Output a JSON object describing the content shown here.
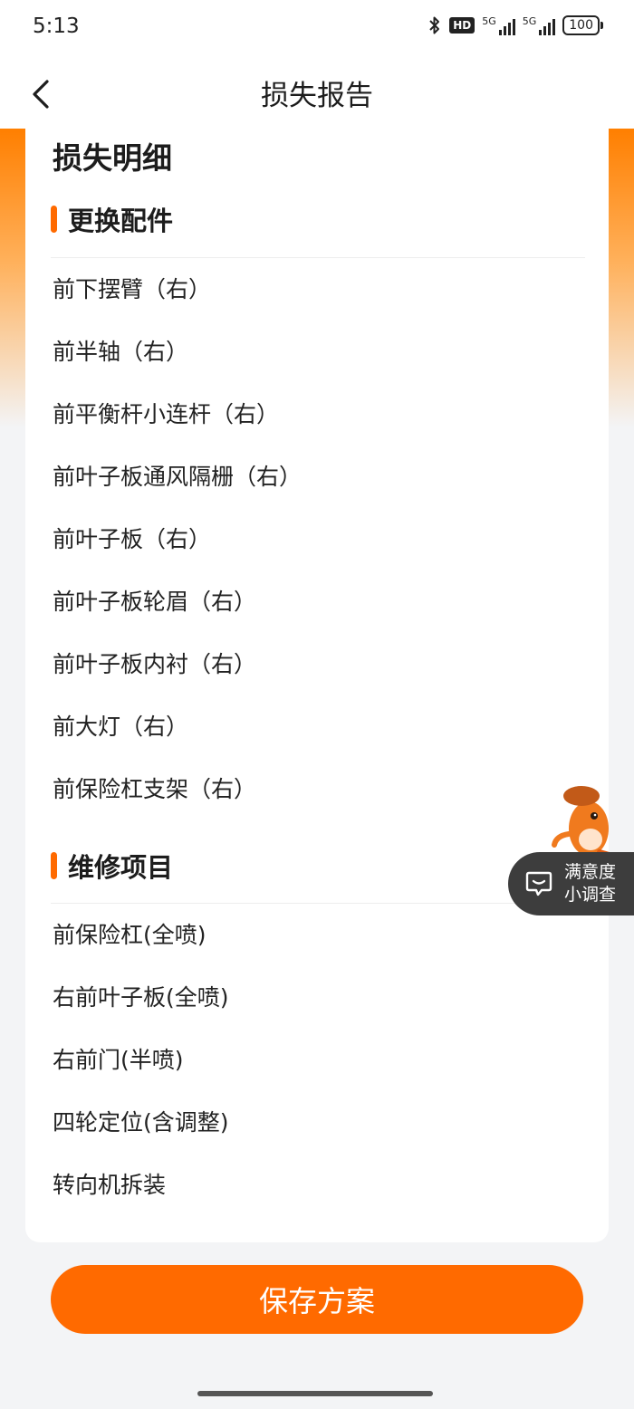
{
  "status_bar": {
    "time": "5:13",
    "hd_label": "HD",
    "network_1": "5G",
    "network_2": "5G",
    "battery": "100",
    "icons": [
      "bluetooth-icon",
      "hd-voice-icon",
      "signal-icon",
      "signal-icon",
      "battery-icon"
    ]
  },
  "header": {
    "title": "损失报告",
    "back_icon": "chevron-left-icon"
  },
  "card": {
    "title": "损失明细",
    "sections": [
      {
        "title": "更换配件",
        "items": [
          "前下摆臂（右）",
          "前半轴（右）",
          "前平衡杆小连杆（右）",
          "前叶子板通风隔栅（右）",
          "前叶子板（右）",
          "前叶子板轮眉（右）",
          "前叶子板内衬（右）",
          "前大灯（右）",
          "前保险杠支架（右）"
        ]
      },
      {
        "title": "维修项目",
        "items": [
          "前保险杠(全喷)",
          "右前叶子板(全喷)",
          "右前门(半喷)",
          "四轮定位(含调整)",
          "转向机拆装"
        ]
      }
    ]
  },
  "survey": {
    "line1": "满意度",
    "line2": "小调查",
    "icon": "chat-bubble-icon",
    "mascot": "fox-mascot-icon"
  },
  "footer": {
    "save_label": "保存方案"
  },
  "colors": {
    "accent": "#ff6a00",
    "background": "#f3f4f6",
    "survey_bg": "#3d3d3d"
  }
}
